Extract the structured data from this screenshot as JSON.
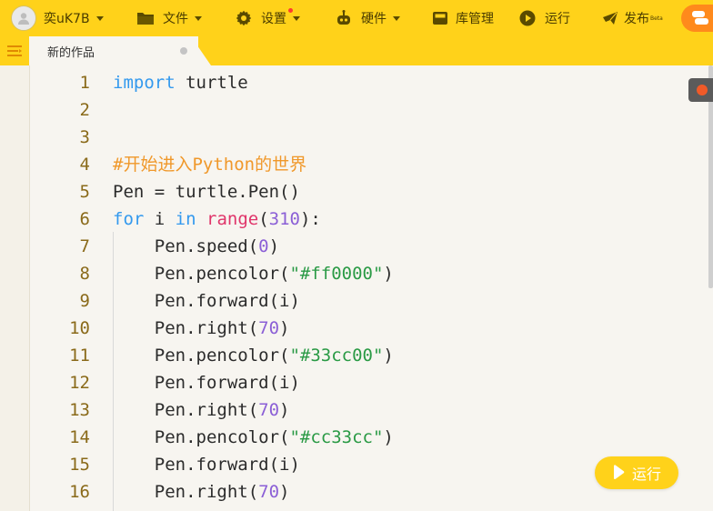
{
  "topbar": {
    "username": "奕uK7B",
    "file_label": "文件",
    "settings_label": "设置",
    "hardware_label": "硬件",
    "library_label": "库管理",
    "run_label": "运行",
    "publish_label": "发布",
    "publish_badge": "Beta"
  },
  "tab": {
    "title": "新的作品"
  },
  "editor": {
    "lines": [
      {
        "num": "1",
        "tokens": [
          [
            "kw",
            "import"
          ],
          [
            "id",
            " turtle"
          ]
        ]
      },
      {
        "num": "2",
        "tokens": []
      },
      {
        "num": "3",
        "tokens": []
      },
      {
        "num": "4",
        "tokens": [
          [
            "com",
            "#开始进入Python的世界"
          ]
        ]
      },
      {
        "num": "5",
        "tokens": [
          [
            "id",
            "Pen = turtle.Pen()"
          ]
        ]
      },
      {
        "num": "6",
        "tokens": [
          [
            "kw",
            "for"
          ],
          [
            "id",
            " i "
          ],
          [
            "kw",
            "in"
          ],
          [
            "id",
            " "
          ],
          [
            "fn",
            "range"
          ],
          [
            "id",
            "("
          ],
          [
            "num",
            "310"
          ],
          [
            "id",
            "):"
          ]
        ]
      },
      {
        "num": "7",
        "tokens": [
          [
            "id",
            "    Pen.speed("
          ],
          [
            "num",
            "0"
          ],
          [
            "id",
            ")"
          ]
        ]
      },
      {
        "num": "8",
        "tokens": [
          [
            "id",
            "    Pen.pencolor("
          ],
          [
            "str",
            "\"#ff0000\""
          ],
          [
            "id",
            ")"
          ]
        ]
      },
      {
        "num": "9",
        "tokens": [
          [
            "id",
            "    Pen.forward(i)"
          ]
        ]
      },
      {
        "num": "10",
        "tokens": [
          [
            "id",
            "    Pen.right("
          ],
          [
            "num",
            "70"
          ],
          [
            "id",
            ")"
          ]
        ]
      },
      {
        "num": "11",
        "tokens": [
          [
            "id",
            "    Pen.pencolor("
          ],
          [
            "str",
            "\"#33cc00\""
          ],
          [
            "id",
            ")"
          ]
        ]
      },
      {
        "num": "12",
        "tokens": [
          [
            "id",
            "    Pen.forward(i)"
          ]
        ]
      },
      {
        "num": "13",
        "tokens": [
          [
            "id",
            "    Pen.right("
          ],
          [
            "num",
            "70"
          ],
          [
            "id",
            ")"
          ]
        ]
      },
      {
        "num": "14",
        "tokens": [
          [
            "id",
            "    Pen.pencolor("
          ],
          [
            "str",
            "\"#cc33cc\""
          ],
          [
            "id",
            ")"
          ]
        ]
      },
      {
        "num": "15",
        "tokens": [
          [
            "id",
            "    Pen.forward(i)"
          ]
        ]
      },
      {
        "num": "16",
        "tokens": [
          [
            "id",
            "    Pen.right("
          ],
          [
            "num",
            "70"
          ],
          [
            "id",
            ")"
          ]
        ]
      }
    ]
  },
  "run_button": {
    "label": "运行"
  },
  "colors": {
    "accent": "#ffd21a",
    "keyword": "#3399ee",
    "builtin": "#e0356a",
    "number": "#8b5fd6",
    "string": "#2a9a45",
    "comment": "#f0982a"
  },
  "icons": [
    "avatar-icon",
    "folder-icon",
    "gear-icon",
    "hardware-icon",
    "library-icon",
    "play-icon",
    "send-icon",
    "menu-icon",
    "play-icon"
  ]
}
